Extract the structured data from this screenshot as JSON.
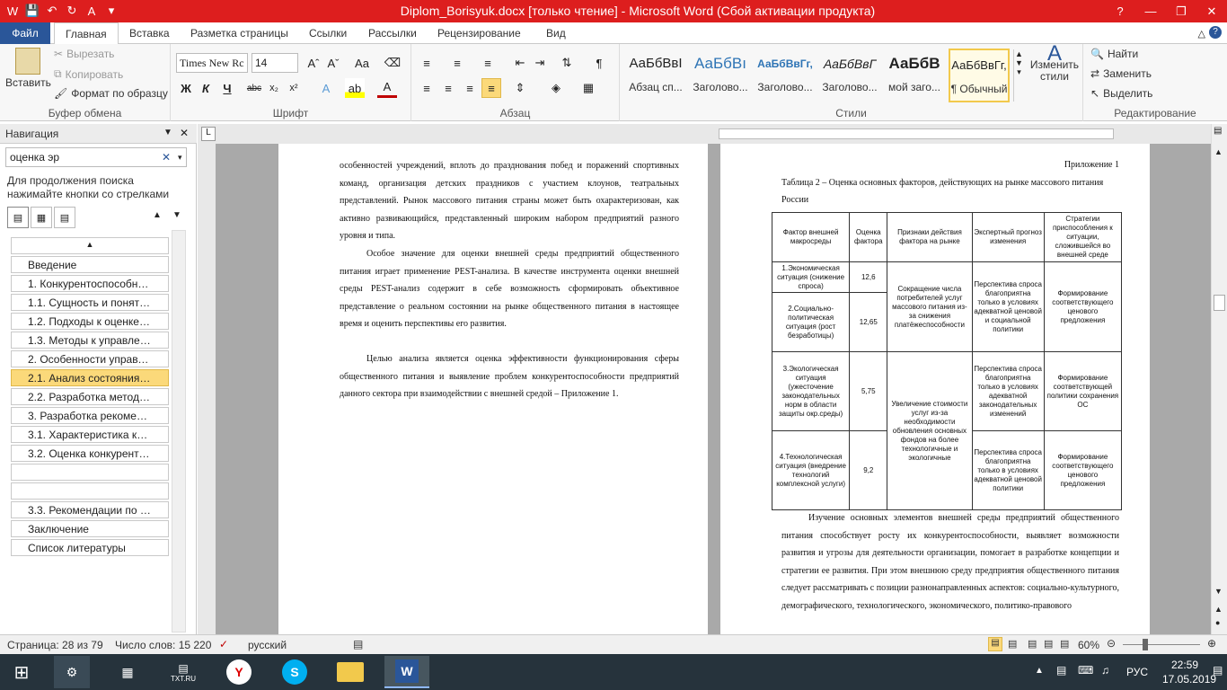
{
  "window": {
    "title": "Diplom_Borisyuk.docx [только чтение]  -  Microsoft Word (Сбой активации продукта)",
    "qat": [
      "save-icon",
      "undo-icon",
      "redo-icon",
      "font-color-icon"
    ]
  },
  "tabs": [
    "Файл",
    "Главная",
    "Вставка",
    "Разметка страницы",
    "Ссылки",
    "Рассылки",
    "Рецензирование",
    "Вид"
  ],
  "ribbon": {
    "clipboard": {
      "paste": "Вставить",
      "cut": "Вырезать",
      "copy": "Копировать",
      "format_painter": "Формат по образцу",
      "label": "Буфер обмена"
    },
    "font": {
      "name": "Times New Rc",
      "size": "14",
      "label": "Шрифт"
    },
    "paragraph": {
      "label": "Абзац"
    },
    "styles": {
      "label": "Стили",
      "items": [
        {
          "sample": "АаБбВвI",
          "name": "Абзац сп..."
        },
        {
          "sample": "АаБбВı",
          "name": "Заголово..."
        },
        {
          "sample": "АаБбВвГг,",
          "name": "Заголово..."
        },
        {
          "sample": "АаБбВвГ",
          "name": "Заголово..."
        },
        {
          "sample": "АаБбВ",
          "name": "мой заго..."
        },
        {
          "sample": "АаБбВвГг,",
          "name": "¶ Обычный"
        }
      ],
      "change": "Изменить стили"
    },
    "editing": {
      "find": "Найти",
      "replace": "Заменить",
      "select": "Выделить",
      "label": "Редактирование"
    }
  },
  "nav": {
    "title": "Навигация",
    "search_value": "оценка эр",
    "hint": "Для продолжения поиска нажимайте кнопки со стрелками",
    "items": [
      "",
      "Введение",
      "1. Конкурентоспособность...",
      "1.1. Сущность и понятие к...",
      "1.2. Подходы к оценке кон...",
      "1.3. Методы к управлению ...",
      "2. Особенности управлени...",
      "2.1. Анализ состояния отра...",
      "2.2. Разработка методов о...",
      "3. Разработка рекомендац...",
      "3.1. Характеристика компа...",
      "3.2. Оценка конкурентосп...",
      "",
      "",
      "3.3. Рекомендации по пов...",
      "Заключение",
      "Список литературы"
    ]
  },
  "page1": {
    "p1": "особенностей учреждений, вплоть до празднования побед и поражений спортивных команд, организация детских праздников с участием клоунов, театральных представлений. Рынок массового питания страны может быть охарактеризован, как активно развивающийся, представленный широким набором предприятий разного уровня и типа.",
    "p2": "Особое значение для оценки внешней среды предприятий общественного питания играет применение PEST-анализа. В качестве инструмента оценки внешней среды PEST-анализ содержит в себе возможность сформировать объективное представление о реальном состоянии на рынке общественного питания в настоящее время и оценить перспективы его развития.",
    "p3": "Целью анализа является оценка эффективности функционирования сферы общественного питания и выявление проблем конкурентоспособности предприятий данного сектора при взаимодействии с внешней средой – Приложение 1."
  },
  "page2": {
    "appendix": "Приложение 1",
    "caption": "Таблица 2 – Оценка основных факторов, действующих на рынке массового питания России",
    "headers": [
      "Фактор внешней макросреды",
      "Оценка фактора",
      "Признаки действия фактора на рынке",
      "Экспертный прогноз изменения",
      "Стратегии приспособления к ситуации, сложившейся во внешней среде"
    ],
    "rows": [
      {
        "factor": "1.Экономическая ситуация (снижение спроса)",
        "score": "12,6",
        "forecast": "Перспектива спроса благоприятна только в условиях адекватной ценовой и социальной политики"
      },
      {
        "factor": "2.Социально-политическая ситуация (рост безработицы)",
        "score": "12,65",
        "forecast": ""
      },
      {
        "factor": "3.Экологическая ситуация (ужесточение законодательных норм в области защиты окр.среды)",
        "score": "5,75",
        "forecast": "Перспектива спроса благоприятна только в условиях адекватной законодательных изменений"
      },
      {
        "factor": "4.Технологическая ситуация (внедрение технологий комплексной услуги)",
        "score": "9,2",
        "forecast": "Перспектива спроса благоприятна только в условиях адекватной ценовой политики"
      }
    ],
    "signs12": "Сокращение числа потребителей услуг массового питания из-за снижения платёжеспособности",
    "signs34": "Увеличение стоимости услуг из-за необходимости обновления основных фондов на более технологичные и экологичные",
    "strat1": "Формирование соответствующего ценового предложения",
    "strat3": "Формирование соответствующей политики сохранения ОС",
    "strat4": "Формирование соответствующего ценового предложения",
    "after": "Изучение основных элементов внешней среды предприятий общественного питания способствует росту их конкурентоспособности, выявляет возможности развития и угрозы для деятельности организации, помогает в разработке концепции и стратегии ее развития. При этом внешнюю среду предприятия общественного питания следует рассматривать с позиции разнонаправленных аспектов: социально-культурного, демографического, технологического, экономического, политико-правового"
  },
  "status": {
    "page": "Страница: 28 из 79",
    "words": "Число слов: 15 220",
    "lang": "русский",
    "zoom": "60%"
  },
  "taskbar": {
    "lang": "РУС",
    "time": "22:59",
    "date": "17.05.2019",
    "apps": [
      "windows-icon",
      "control-panel-icon",
      "calculator-icon",
      "txt-ru-icon",
      "yandex-icon",
      "skype-icon",
      "explorer-icon",
      "word-icon"
    ],
    "txt_label": "TXT.RU"
  }
}
